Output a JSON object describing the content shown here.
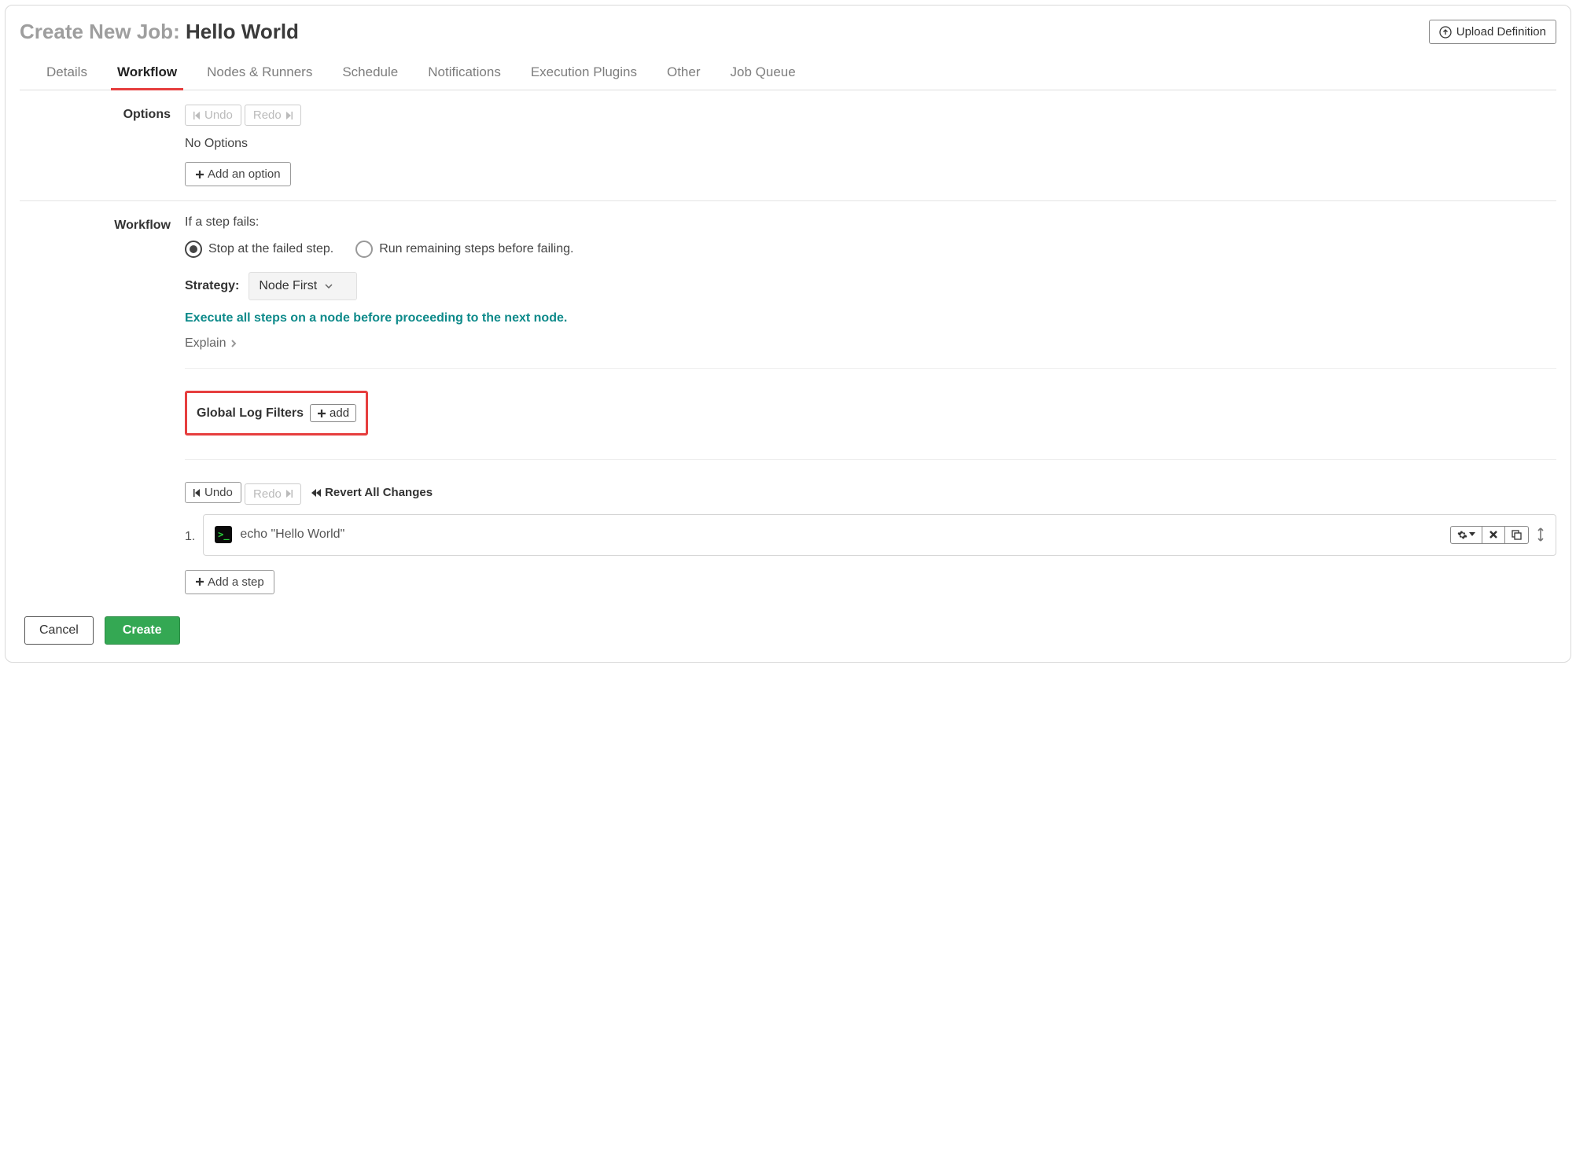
{
  "header": {
    "title_prefix": "Create New Job: ",
    "job_name": "Hello World",
    "upload_label": "Upload Definition"
  },
  "tabs": [
    {
      "label": "Details",
      "active": false
    },
    {
      "label": "Workflow",
      "active": true
    },
    {
      "label": "Nodes & Runners",
      "active": false
    },
    {
      "label": "Schedule",
      "active": false
    },
    {
      "label": "Notifications",
      "active": false
    },
    {
      "label": "Execution Plugins",
      "active": false
    },
    {
      "label": "Other",
      "active": false
    },
    {
      "label": "Job Queue",
      "active": false
    }
  ],
  "options": {
    "section_label": "Options",
    "undo_label": "Undo",
    "redo_label": "Redo",
    "no_options_text": "No Options",
    "add_option_label": "Add an option"
  },
  "workflow": {
    "section_label": "Workflow",
    "step_fail_label": "If a step fails:",
    "radio_stop": "Stop at the failed step.",
    "radio_run_remaining": "Run remaining steps before failing.",
    "radio_selected": "stop",
    "strategy_label": "Strategy:",
    "strategy_value": "Node First",
    "strategy_desc": "Execute all steps on a node before proceeding to the next node.",
    "explain_label": "Explain",
    "global_log_filters_label": "Global Log Filters",
    "add_filter_label": "add",
    "undo_label": "Undo",
    "redo_label": "Redo",
    "revert_label": "Revert All Changes",
    "steps": [
      {
        "num": "1.",
        "command": "echo \"Hello World\""
      }
    ],
    "add_step_label": "Add a step"
  },
  "footer": {
    "cancel_label": "Cancel",
    "create_label": "Create"
  }
}
